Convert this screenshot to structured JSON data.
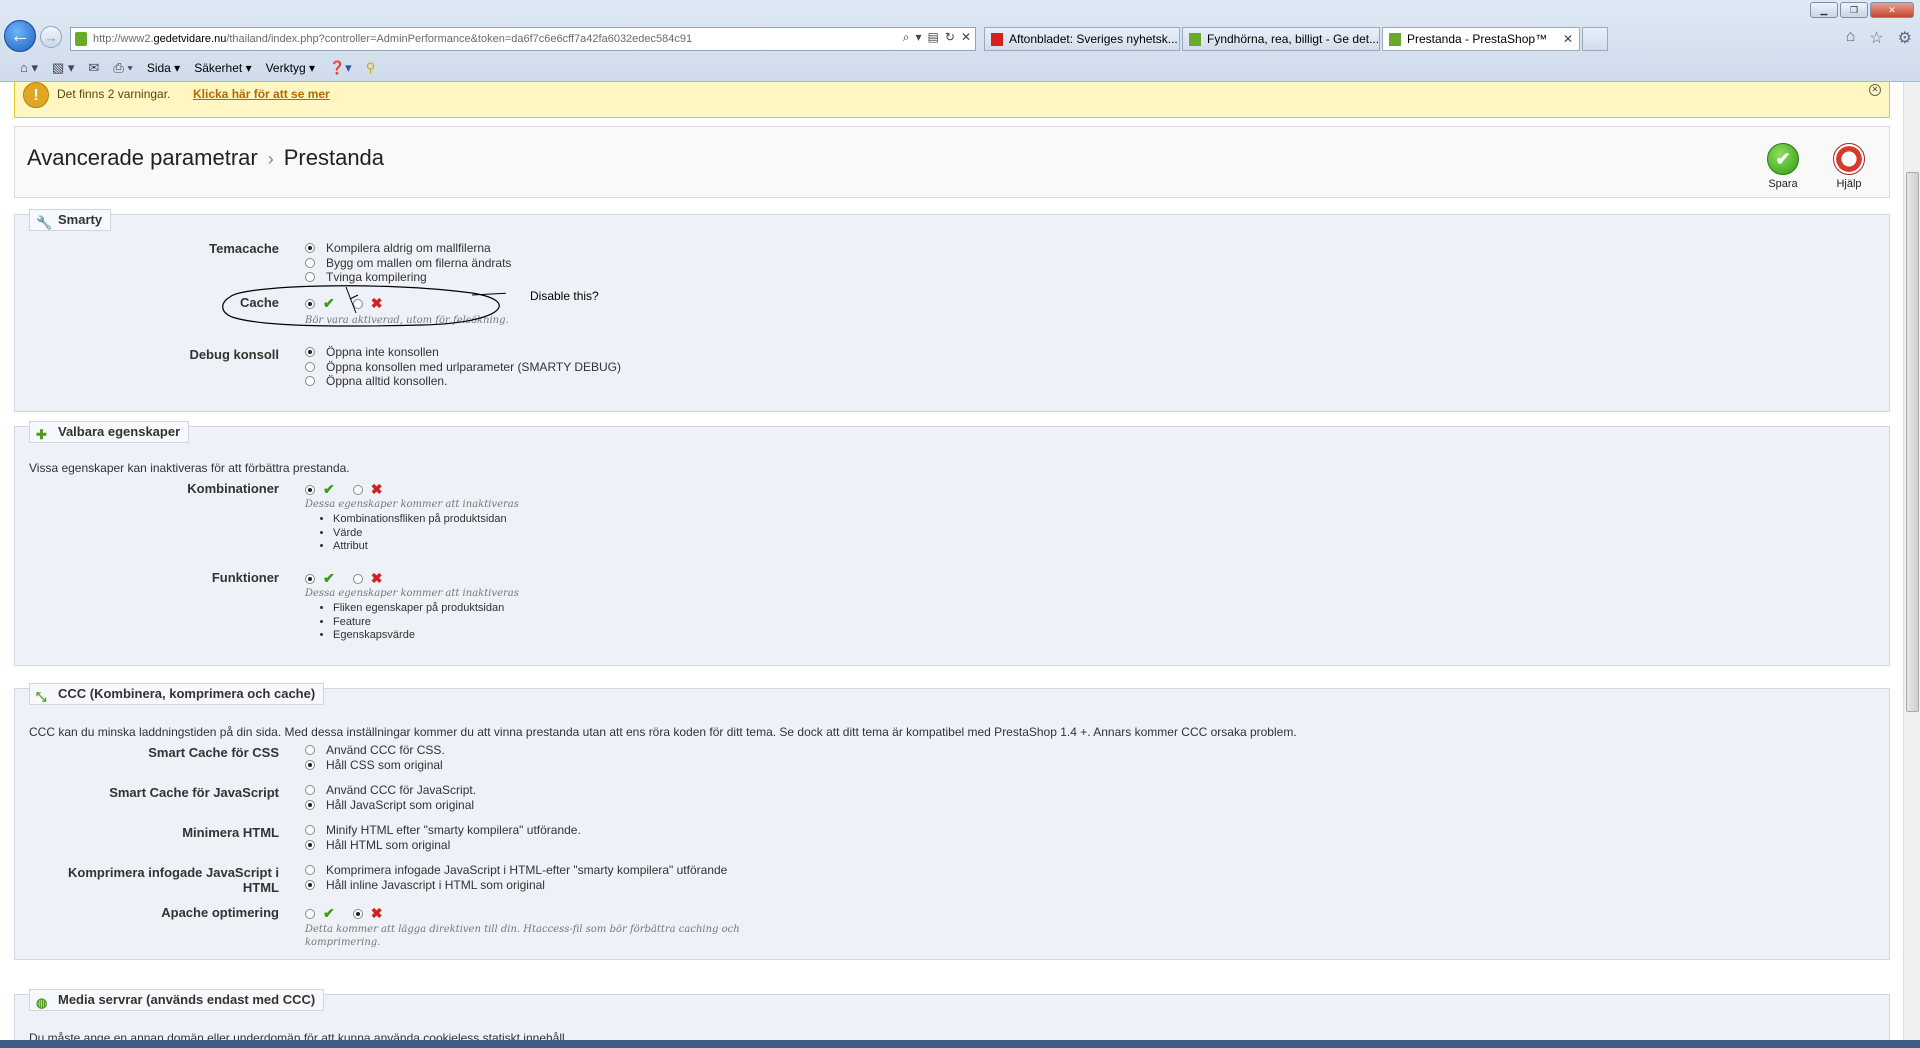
{
  "browser": {
    "url_prefix": "http://www2.",
    "url_domain": "gedetvidare.nu",
    "url_rest": "/thailand/index.php?controller=AdminPerformance&token=da6f7c6e6cff7a42fa6032edec584c91",
    "tabs": [
      {
        "label": "Aftonbladet: Sveriges nyhetsk..."
      },
      {
        "label": "Fyndhörna, rea, billigt - Ge det..."
      },
      {
        "label": "Prestanda - PrestaShop™"
      }
    ],
    "cmd": {
      "page": "Sida",
      "safety": "Säkerhet",
      "tools": "Verktyg"
    }
  },
  "warning": {
    "text": "Det finns 2 varningar.",
    "link": "Klicka här för att se mer"
  },
  "header": {
    "crumb_parent": "Avancerade parametrar",
    "crumb_sep": "›",
    "crumb_current": "Prestanda",
    "save_label": "Spara",
    "help_label": "Hjälp"
  },
  "annotation": {
    "text": "Disable this?"
  },
  "smarty": {
    "legend": "Smarty",
    "temacache": {
      "label": "Temacache",
      "options": [
        "Kompilera aldrig om mallfilerna",
        "Bygg om mallen om filerna ändrats",
        "Tvinga kompilering"
      ],
      "selected": 0
    },
    "cache": {
      "label": "Cache",
      "hint": "Bör vara aktiverad, utom för felsökning.",
      "value": "yes"
    },
    "debug": {
      "label": "Debug konsoll",
      "options": [
        "Öppna inte konsollen",
        "Öppna konsollen med urlparameter (SMARTY DEBUG)",
        "Öppna alltid konsollen."
      ],
      "selected": 0
    }
  },
  "features": {
    "legend": "Valbara egenskaper",
    "intro": "Vissa egenskaper kan inaktiveras för att förbättra prestanda.",
    "combinations": {
      "label": "Kombinationer",
      "hint": "Dessa egenskaper kommer att inaktiveras",
      "items": [
        "Kombinationsfliken på produktsidan",
        "Värde",
        "Attribut"
      ],
      "value": "yes"
    },
    "functions": {
      "label": "Funktioner",
      "hint": "Dessa egenskaper kommer att inaktiveras",
      "items": [
        "Fliken egenskaper på produktsidan",
        "Feature",
        "Egenskapsvärde"
      ],
      "value": "yes"
    }
  },
  "ccc": {
    "legend": "CCC (Kombinera, komprimera och cache)",
    "intro": "CCC kan du minska laddningstiden på din sida. Med dessa inställningar kommer du att vinna prestanda utan att ens röra koden för ditt tema. Se dock att ditt tema är kompatibel med PrestaShop 1.4 +. Annars kommer CCC orsaka problem.",
    "css": {
      "label": "Smart Cache för CSS",
      "options": [
        "Använd CCC för CSS.",
        "Håll CSS som original"
      ],
      "selected": 1
    },
    "js": {
      "label": "Smart Cache för JavaScript",
      "options": [
        "Använd CCC för JavaScript.",
        "Håll JavaScript som original"
      ],
      "selected": 1
    },
    "html": {
      "label": "Minimera HTML",
      "options": [
        "Minify HTML efter \"smarty kompilera\" utförande.",
        "Håll HTML som original"
      ],
      "selected": 1
    },
    "inline": {
      "label_1": "Komprimera infogade JavaScript i",
      "label_2": "HTML",
      "options": [
        "Komprimera infogade JavaScript i HTML-efter \"smarty kompilera\" utförande",
        "Håll inline Javascript i HTML som original"
      ],
      "selected": 1
    },
    "apache": {
      "label": "Apache optimering",
      "hint_1": "Detta kommer att lägga direktiven till din. Htaccess-fil som bör förbättra caching och",
      "hint_2": "komprimering.",
      "value": "no"
    }
  },
  "media": {
    "legend": "Media servrar (används endast med CCC)",
    "intro": "Du måste ange en annan domän eller underdomän för att kunna använda cookieless statiskt innehåll."
  }
}
